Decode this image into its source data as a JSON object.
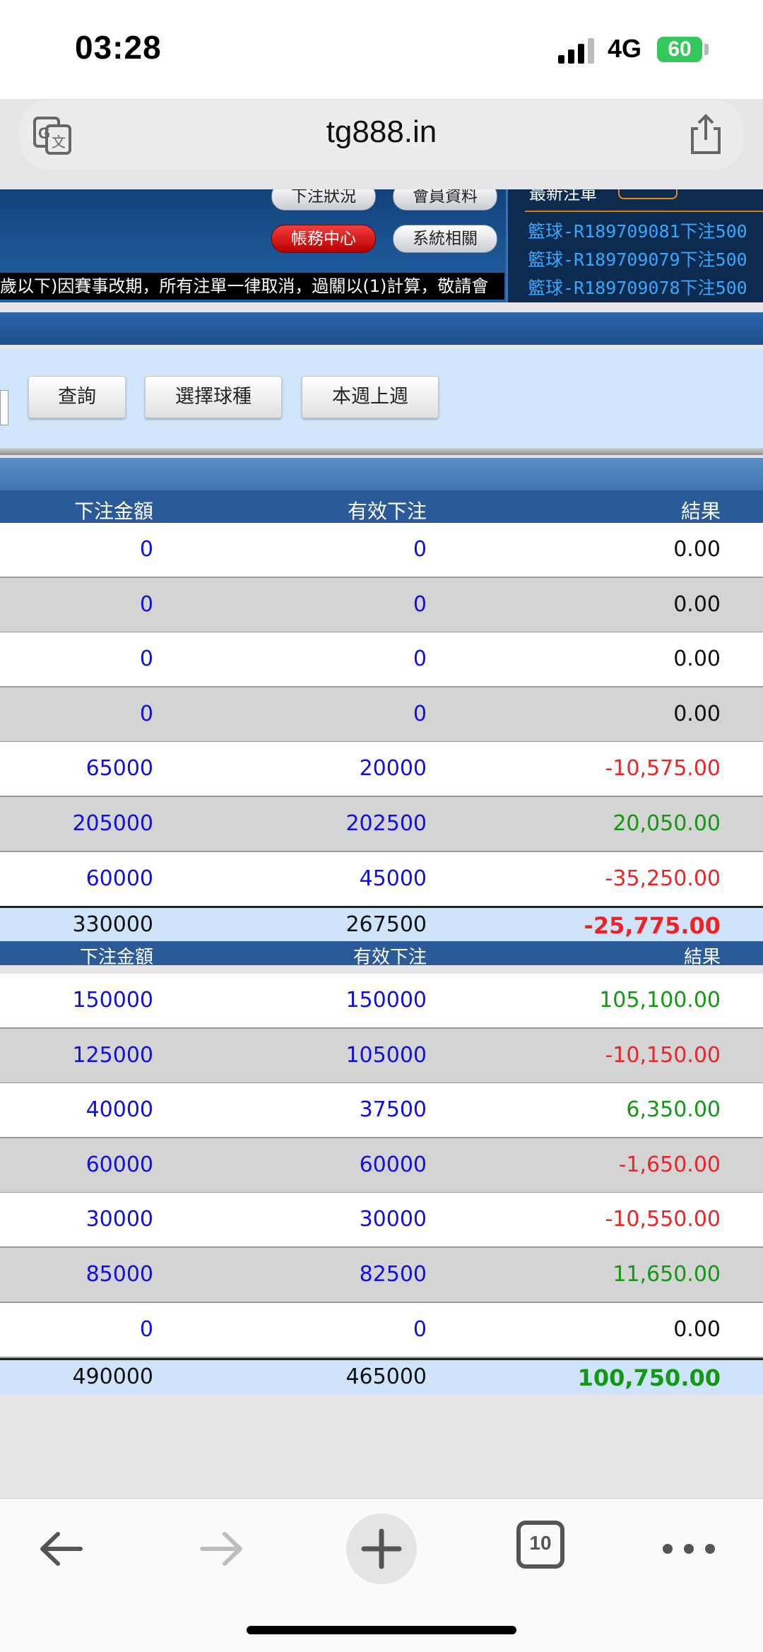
{
  "status_bar": {
    "time": "03:28",
    "network": "4G",
    "battery": "60"
  },
  "browser": {
    "url": "tg888.in",
    "tab_count": "10"
  },
  "header": {
    "buttons": [
      "下注狀況",
      "會員資料",
      "帳務中心",
      "系統相關"
    ],
    "ticker": "歲以下)因賽事改期，所有注單一律取消，過關以(1)計算，敬請會",
    "news_title": "最新注單",
    "news_lines": [
      "籃球-R189709081下注500",
      "籃球-R189709079下注500",
      "籃球-R189709078下注500"
    ]
  },
  "search": {
    "buttons": [
      "查詢",
      "選擇球種",
      "本週上週"
    ]
  },
  "tables": [
    {
      "headers": [
        "下注金額",
        "有效下注",
        "結果"
      ],
      "rows": [
        {
          "amount": "0",
          "valid": "0",
          "result": "0.00",
          "color": "black"
        },
        {
          "amount": "0",
          "valid": "0",
          "result": "0.00",
          "color": "black"
        },
        {
          "amount": "0",
          "valid": "0",
          "result": "0.00",
          "color": "black"
        },
        {
          "amount": "0",
          "valid": "0",
          "result": "0.00",
          "color": "black"
        },
        {
          "amount": "65000",
          "valid": "20000",
          "result": "-10,575.00",
          "color": "red"
        },
        {
          "amount": "205000",
          "valid": "202500",
          "result": "20,050.00",
          "color": "green"
        },
        {
          "amount": "60000",
          "valid": "45000",
          "result": "-35,250.00",
          "color": "red"
        }
      ],
      "total": {
        "amount": "330000",
        "valid": "267500",
        "result": "-25,775.00",
        "color": "red"
      }
    },
    {
      "headers": [
        "下注金額",
        "有效下注",
        "結果"
      ],
      "rows": [
        {
          "amount": "150000",
          "valid": "150000",
          "result": "105,100.00",
          "color": "green"
        },
        {
          "amount": "125000",
          "valid": "105000",
          "result": "-10,150.00",
          "color": "red"
        },
        {
          "amount": "40000",
          "valid": "37500",
          "result": "6,350.00",
          "color": "green"
        },
        {
          "amount": "60000",
          "valid": "60000",
          "result": "-1,650.00",
          "color": "red"
        },
        {
          "amount": "30000",
          "valid": "30000",
          "result": "-10,550.00",
          "color": "red"
        },
        {
          "amount": "85000",
          "valid": "82500",
          "result": "11,650.00",
          "color": "green"
        },
        {
          "amount": "0",
          "valid": "0",
          "result": "0.00",
          "color": "black"
        }
      ],
      "total": {
        "amount": "490000",
        "valid": "465000",
        "result": "100,750.00",
        "color": "green"
      }
    }
  ],
  "toolbar": {
    "icons": [
      "back-icon",
      "forward-icon",
      "new-tab-icon",
      "tabs-icon",
      "more-icon"
    ]
  }
}
